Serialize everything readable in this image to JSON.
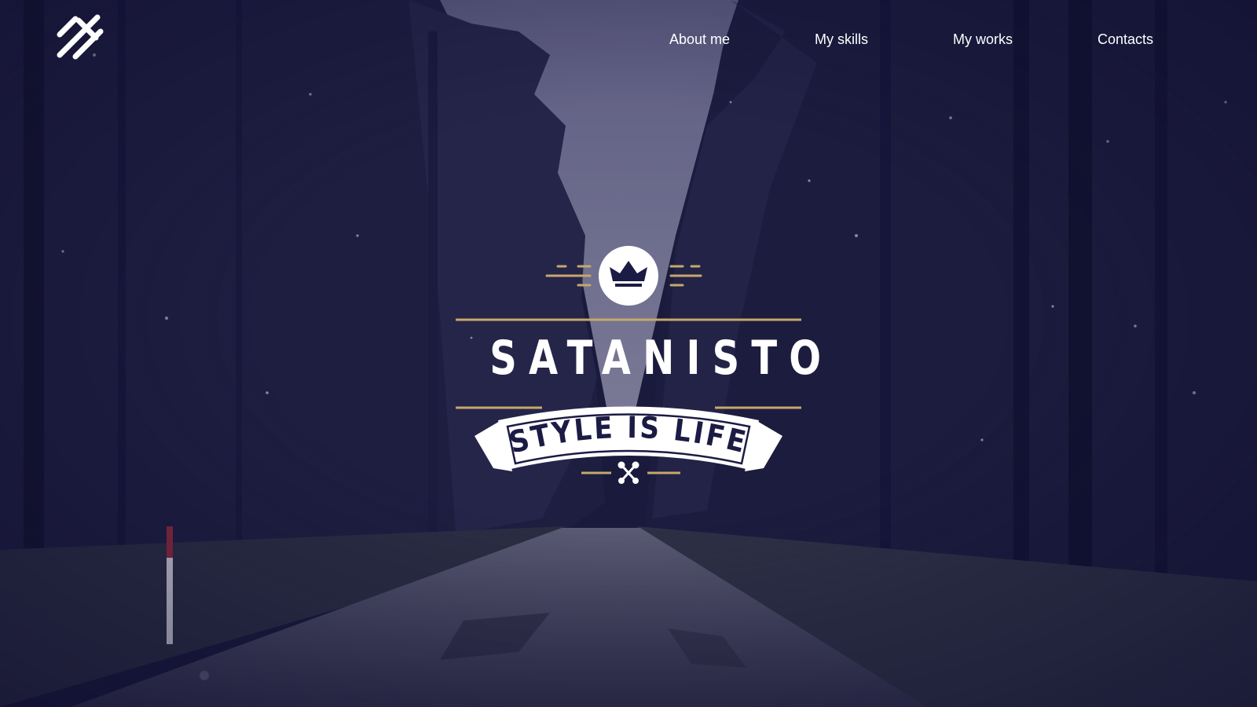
{
  "nav": {
    "items": [
      {
        "label": "About me"
      },
      {
        "label": "My skills"
      },
      {
        "label": "My works"
      },
      {
        "label": "Contacts"
      }
    ]
  },
  "hero": {
    "brand": "SATANISTO",
    "tagline": "STYLE IS LIFE",
    "emblem_icon": "crown-icon",
    "ornament_icon": "crossed-arrows-icon"
  },
  "icons": {
    "logo": "monogram-logo-icon"
  },
  "colors": {
    "overlay": "#171640",
    "accent_gold": "#c6a86a",
    "text": "#ffffff"
  }
}
